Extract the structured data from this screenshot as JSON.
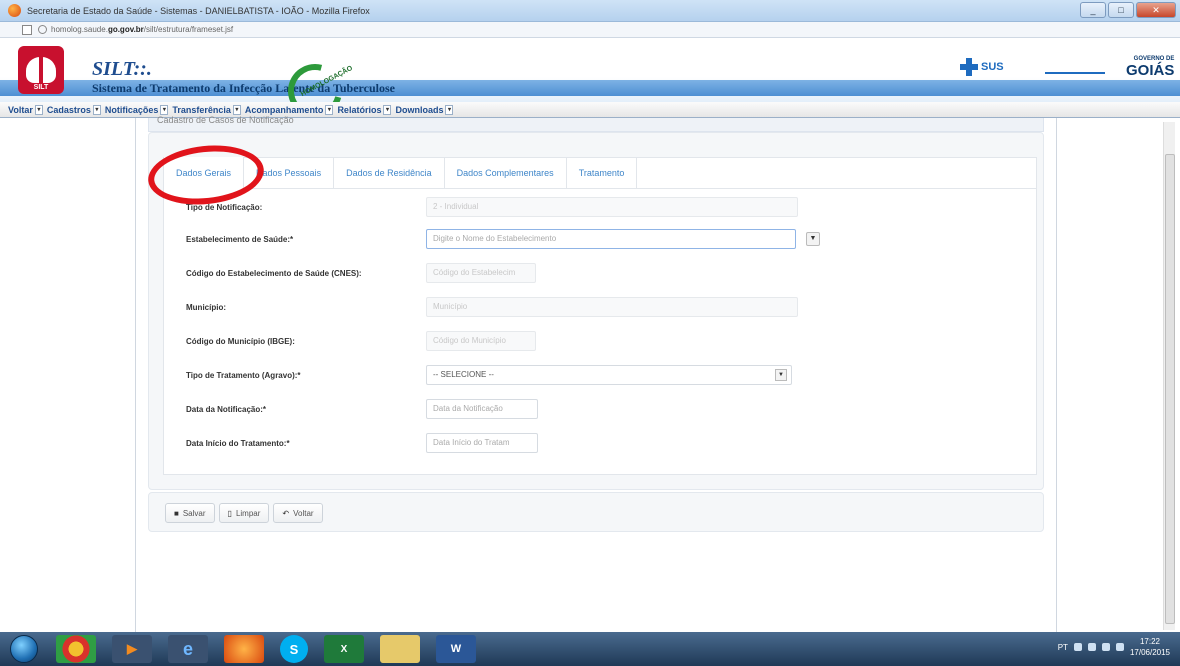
{
  "window": {
    "title": "Secretaria de Estado da Saúde - Sistemas - DANIELBATISTA - IOÃO - Mozilla Firefox",
    "url_prefix": "homolog.saude.",
    "url_domain": "go.gov.br",
    "url_suffix": "/silt/estrutura/frameset.jsf"
  },
  "header": {
    "acronym": "SILT::.",
    "fullname": "Sistema de Tratamento da Infecção Latente da Tuberculose",
    "logo_tag": "SILT",
    "badge_text": "HOMOLOGAÇÃO",
    "sus_label": "SUS",
    "gov_small": "GOVERNO DE",
    "gov_big": "GOIÁS"
  },
  "menu": [
    "Voltar",
    "Cadastros",
    "Notificações",
    "Transferência",
    "Acompanhamento",
    "Relatórios",
    "Downloads"
  ],
  "panel_heading": "Cadastro de Casos de Notificação",
  "tabs": [
    "Dados Gerais",
    "Dados Pessoais",
    "Dados de Residência",
    "Dados Complementares",
    "Tratamento"
  ],
  "form": {
    "tipo_notificacao": {
      "label": "Tipo de Notificação:",
      "value": "2 - Individual"
    },
    "estabelecimento": {
      "label": "Estabelecimento de Saúde:*",
      "placeholder": "Digite o Nome do Estabelecimento"
    },
    "cnes": {
      "label": "Código do Estabelecimento de Saúde (CNES):",
      "placeholder": "Código do Estabelecim"
    },
    "municipio": {
      "label": "Município:",
      "placeholder": "Município"
    },
    "ibge": {
      "label": "Código do Município (IBGE):",
      "placeholder": "Código do Município"
    },
    "tratamento": {
      "label": "Tipo de Tratamento (Agravo):*",
      "value": "-- SELECIONE --"
    },
    "data_notificacao": {
      "label": "Data da Notificação:*",
      "placeholder": "Data da Notificação"
    },
    "data_inicio": {
      "label": "Data Início do Tratamento:*",
      "placeholder": "Data Início do Tratam"
    }
  },
  "buttons": {
    "save": "Salvar",
    "clear": "Limpar",
    "back": "Voltar"
  },
  "taskbar": {
    "clock_time": "17:22",
    "clock_date": "17/06/2015",
    "lang": "PT"
  },
  "colors": {
    "annotation": "#e1141b",
    "accent": "#3f86c9",
    "brand": "#1f4d8f"
  }
}
